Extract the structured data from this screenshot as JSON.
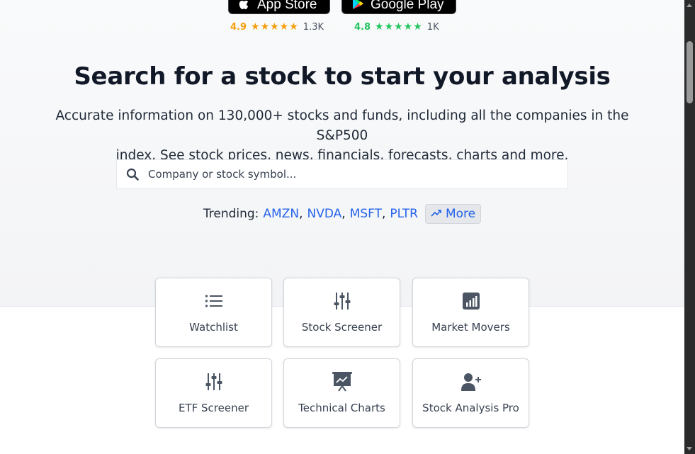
{
  "app_badges": {
    "app_store": {
      "label": "App Store",
      "rating": "4.9",
      "stars": "★★★★★",
      "count": "1.3K",
      "color": "#f59e0b"
    },
    "google_play": {
      "label": "Google Play",
      "rating": "4.8",
      "stars": "★★★★★",
      "count": "1K",
      "color": "#22c55e"
    }
  },
  "hero": {
    "title": "Search for a stock to start your analysis",
    "subtitle_line1": "Accurate information on 130,000+ stocks and funds, including all the companies in the S&P500",
    "subtitle_line2": "index. See stock prices, news, financials, forecasts, charts and more."
  },
  "search": {
    "placeholder": "Company or stock symbol..."
  },
  "trending": {
    "label": "Trending:",
    "items": [
      "AMZN",
      "NVDA",
      "MSFT",
      "PLTR"
    ],
    "more_label": "More"
  },
  "cards": [
    {
      "label": "Watchlist",
      "icon": "list-icon"
    },
    {
      "label": "Stock Screener",
      "icon": "sliders-icon"
    },
    {
      "label": "Market Movers",
      "icon": "bar-chart-icon"
    },
    {
      "label": "ETF Screener",
      "icon": "sliders-icon"
    },
    {
      "label": "Technical Charts",
      "icon": "presentation-chart-icon"
    },
    {
      "label": "Stock Analysis Pro",
      "icon": "user-plus-icon"
    }
  ],
  "colors": {
    "link": "#2563eb",
    "title": "#111827",
    "icon": "#4b5563"
  }
}
